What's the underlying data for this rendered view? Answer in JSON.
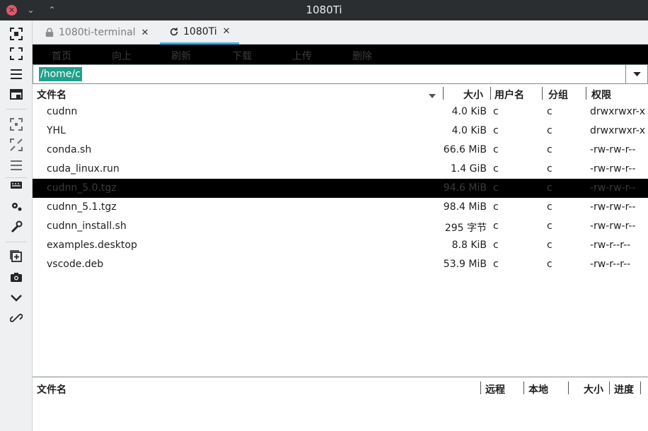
{
  "window": {
    "title": "1080Ti"
  },
  "tabs": [
    {
      "label": "1080ti-terminal",
      "icon": "lock-icon",
      "active": false
    },
    {
      "label": "1080Ti",
      "icon": "refresh-icon",
      "active": true
    }
  ],
  "toolbar": {
    "home": "首页",
    "up": "向上",
    "refresh": "刷新",
    "download": "下载",
    "upload": "上传",
    "delete": "删除"
  },
  "path": {
    "value": "/home/c"
  },
  "columns": {
    "name": "文件名",
    "size": "大小",
    "user": "用户名",
    "group": "分组",
    "perm": "权限"
  },
  "files": [
    {
      "name": "cudnn",
      "size": "4.0 KiB",
      "user": "c",
      "group": "c",
      "perm": "drwxrwxr-x",
      "selected": false
    },
    {
      "name": "YHL",
      "size": "4.0 KiB",
      "user": "c",
      "group": "c",
      "perm": "drwxrwxr-x",
      "selected": false
    },
    {
      "name": "conda.sh",
      "size": "66.6 MiB",
      "user": "c",
      "group": "c",
      "perm": "-rw-rw-r--",
      "selected": false
    },
    {
      "name": "cuda_linux.run",
      "size": "1.4 GiB",
      "user": "c",
      "group": "c",
      "perm": "-rw-rw-r--",
      "selected": false
    },
    {
      "name": "cudnn_5.0.tgz",
      "size": "94.6 MiB",
      "user": "c",
      "group": "c",
      "perm": "-rw-rw-r--",
      "selected": true
    },
    {
      "name": "cudnn_5.1.tgz",
      "size": "98.4 MiB",
      "user": "c",
      "group": "c",
      "perm": "-rw-rw-r--",
      "selected": false
    },
    {
      "name": "cudnn_install.sh",
      "size": "295 字节",
      "user": "c",
      "group": "c",
      "perm": "-rw-rw-r--",
      "selected": false
    },
    {
      "name": "examples.desktop",
      "size": "8.8 KiB",
      "user": "c",
      "group": "c",
      "perm": "-rw-r--r--",
      "selected": false
    },
    {
      "name": "vscode.deb",
      "size": "53.9 MiB",
      "user": "c",
      "group": "c",
      "perm": "-rw-r--r--",
      "selected": false
    }
  ],
  "transfer": {
    "name": "文件名",
    "remote": "远程",
    "local": "本地",
    "size": "大小",
    "progress": "进度"
  },
  "colors": {
    "accent": "#3daee9",
    "path_highlight": "#1fa18b",
    "titlebar": "#2b2e30",
    "close": "#e0596a"
  }
}
